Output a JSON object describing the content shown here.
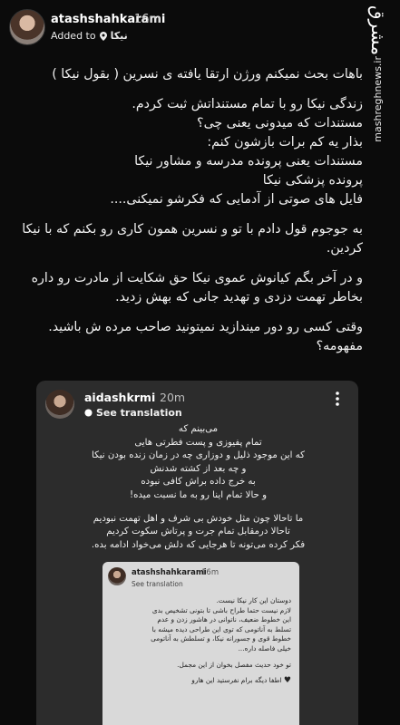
{
  "story": {
    "username": "atashshahkarami",
    "time": "16m",
    "added_prefix": "Added to",
    "added_highlight": "نیکا",
    "logo": "مشرق",
    "logo_url": "mashreghnews.ir"
  },
  "post": {
    "paragraphs": [
      "باهات بحث نمیکنم ورژن ارتقا یافته ی نسرین ( بقول نیکا )",
      "زندگی نیکا رو با تمام مستنداتش ثبت کردم.\nمستندات که میدونی یعنی چی؟\nبذار یه کم برات بازشون کنم:\nمستندات یعنی پرونده مدرسه و مشاور نیکا\nپرونده پزشکی نیکا\nفایل های صوتی از آدمایی که فکرشو نمیکنی....",
      "به جوجوم قول دادم با تو و نسرین همون کاری رو بکنم که با نیکا کردین.",
      "و در آخر بگم کیانوش عموی نیکا حق شکایت از مادرت رو داره بخاطر تهمت دزدی و تهدید جانی که بهش زدید.",
      "وقتی کسی رو دور میندازید نمیتونید صاحب مرده ش باشید.\nمفهومه؟"
    ]
  },
  "comment": {
    "username": "aidashkrmi",
    "time": "20m",
    "see_translation": "See translation",
    "paragraphs": [
      "می‌بینم که\nتمام پفیوزی و پست فطرتی هایی\nکه این موجود ذلیل و دوزاری چه در زمان زنده بودن نیکا\nو چه بعد از کشته شدنش\nبه خرج داده براش کافی نبوده\nو حالا تمام اینا رو به ما نسبت میده!",
      "ما تاحالا چون مثل خودش بی شرف و اهل تهمت نبودیم\nتاحالا درمقابل تمام جرت و پرتاش سکوت کردیم\nفکر کرده می‌تونه تا هرجایی که دلش می‌خواد ادامه بده."
    ]
  },
  "nested": {
    "username": "atashshahkarami",
    "time": "16m",
    "see_translation": "See translation",
    "paragraphs": [
      "دوستان این کار نیکا نیست.\nلازم نیست حتما طراح باشی تا بتونی تشخیص بدی\nاین خطوط ضعیف، ناتوانی در هاشور زدن و عدم\nتسلط به آناتومی که توی این طراحی دیده میشه با\nخطوط قوی و جسورانه نیکا، و تسلطش به آناتومی\nخیلی فاصله داره...",
      "تو خود حدیث مفصل بخوان از این مجمل.",
      "اطفا دیگه برام نفرستید این هارو"
    ]
  }
}
